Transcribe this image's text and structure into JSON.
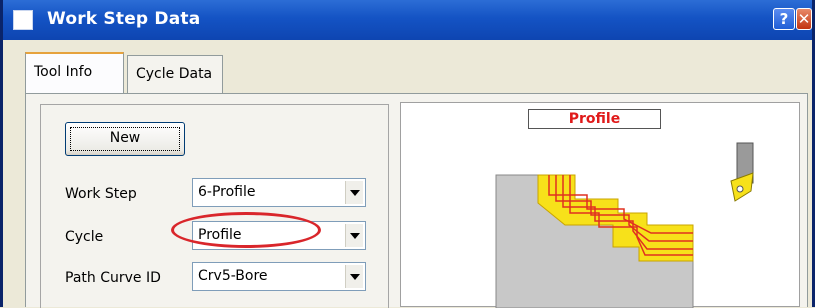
{
  "window": {
    "title": "Work Step Data",
    "help_label": "?",
    "close_label": "✕"
  },
  "tabs": [
    {
      "label": "Tool Info",
      "active": true
    },
    {
      "label": "Cycle Data",
      "active": false
    }
  ],
  "tool_info": {
    "new_button": "New",
    "work_step": {
      "label": "Work Step",
      "value": "6-Profile"
    },
    "cycle": {
      "label": "Cycle",
      "value": "Profile"
    },
    "path_curve": {
      "label": "Path Curve ID",
      "value": "Crv5-Bore"
    }
  },
  "preview": {
    "title": "Profile"
  },
  "colors": {
    "titlebar": "#0e45b1",
    "highlight_oval": "#d9262b",
    "preview_title": "#e01a1a",
    "stock": "#c8c8c8",
    "toolpath": "#f7e11a"
  }
}
